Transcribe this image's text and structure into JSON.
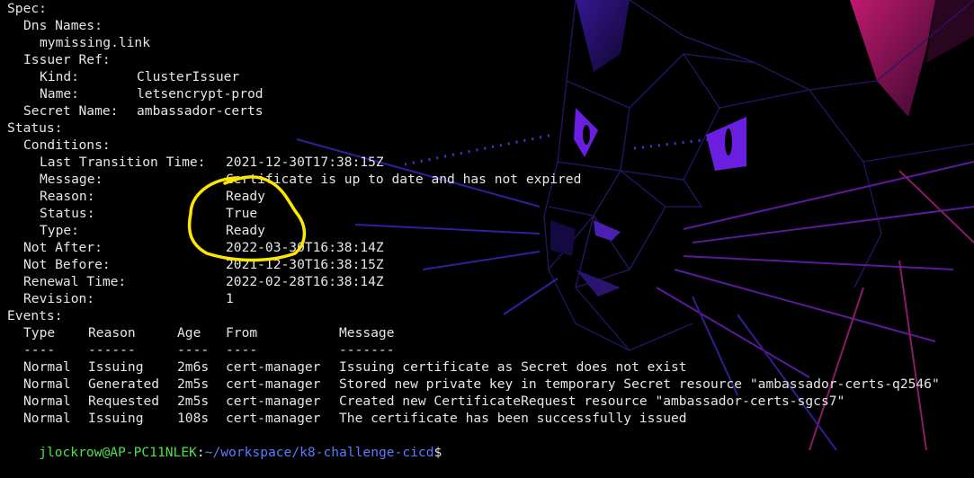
{
  "spec": {
    "label": "Spec:",
    "dns_names_label": "Dns Names:",
    "dns_name": "mymissing.link",
    "issuer_ref_label": "Issuer Ref:",
    "kind_label": "Kind:",
    "kind_value": "ClusterIssuer",
    "name_label": "Name:",
    "name_value": "letsencrypt-prod",
    "secret_name_label": "Secret Name:",
    "secret_name_value": "ambassador-certs"
  },
  "status": {
    "label": "Status:",
    "conditions_label": "Conditions:",
    "last_transition_label": "Last Transition Time:",
    "last_transition_value": "2021-12-30T17:38:15Z",
    "message_label": "Message:",
    "message_value": "Certificate is up to date and has not expired",
    "reason_label": "Reason:",
    "reason_value": "Ready",
    "status_label": "Status:",
    "status_value": "True",
    "type_label": "Type:",
    "type_value": "Ready",
    "not_after_label": "Not After:",
    "not_after_value": "2022-03-30T16:38:14Z",
    "not_before_label": "Not Before:",
    "not_before_value": "2021-12-30T16:38:15Z",
    "renewal_label": "Renewal Time:",
    "renewal_value": "2022-02-28T16:38:14Z",
    "revision_label": "Revision:",
    "revision_value": "1"
  },
  "events": {
    "label": "Events:",
    "headers": {
      "type": "Type",
      "reason": "Reason",
      "age": "Age",
      "from": "From",
      "message": "Message"
    },
    "separators": {
      "type": "----",
      "reason": "------",
      "age": "----",
      "from": "----",
      "message": "-------"
    },
    "rows": [
      {
        "type": "Normal",
        "reason": "Issuing",
        "age": "2m6s",
        "from": "cert-manager",
        "message": "Issuing certificate as Secret does not exist"
      },
      {
        "type": "Normal",
        "reason": "Generated",
        "age": "2m5s",
        "from": "cert-manager",
        "message": "Stored new private key in temporary Secret resource \"ambassador-certs-q2546\""
      },
      {
        "type": "Normal",
        "reason": "Requested",
        "age": "2m5s",
        "from": "cert-manager",
        "message": "Created new CertificateRequest resource \"ambassador-certs-sgcs7\""
      },
      {
        "type": "Normal",
        "reason": "Issuing",
        "age": "108s",
        "from": "cert-manager",
        "message": "The certificate has been successfully issued"
      }
    ]
  },
  "prompt": {
    "user_host": "jlockrow@AP-PC11NLEK",
    "path": "~/workspace/k8-challenge-cicd",
    "symbol": "$"
  },
  "colors": {
    "background": "#000000",
    "text": "#e6e6e6",
    "prompt_user": "#4ee04e",
    "prompt_path": "#5a7cff",
    "annotation": "#ffe600",
    "wallpaper_purple": "#5b2ad6",
    "wallpaper_magenta": "#b0126a"
  }
}
